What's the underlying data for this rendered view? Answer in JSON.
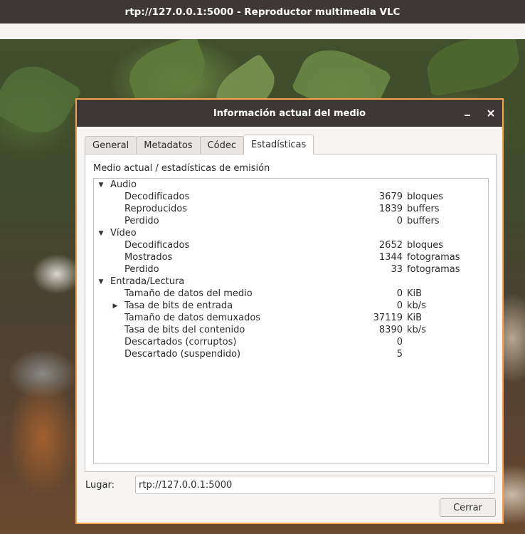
{
  "window": {
    "title": "rtp://127.0.0.1:5000 - Reproductor multimedia VLC"
  },
  "dialog": {
    "title": "Información actual del medio",
    "minimize_icon": "minimize-icon",
    "close_icon": "close-icon",
    "tabs": [
      {
        "label": "General",
        "active": false
      },
      {
        "label": "Metadatos",
        "active": false
      },
      {
        "label": "Códec",
        "active": false
      },
      {
        "label": "Estadísticas",
        "active": true
      }
    ],
    "panel_heading": "Medio actual / estadísticas de emisión",
    "tree": {
      "audio": {
        "label": "Audio",
        "rows": [
          {
            "label": "Decodificados",
            "value": "3679",
            "unit": "bloques"
          },
          {
            "label": "Reproducidos",
            "value": "1839",
            "unit": "buffers"
          },
          {
            "label": "Perdido",
            "value": "0",
            "unit": "buffers"
          }
        ]
      },
      "video": {
        "label": "Vídeo",
        "rows": [
          {
            "label": "Decodificados",
            "value": "2652",
            "unit": "bloques"
          },
          {
            "label": "Mostrados",
            "value": "1344",
            "unit": "fotogramas"
          },
          {
            "label": "Perdido",
            "value": "33",
            "unit": "fotogramas"
          }
        ]
      },
      "input": {
        "label": "Entrada/Lectura",
        "rows": [
          {
            "label": "Tamaño de datos del medio",
            "value": "0",
            "unit": "KiB"
          },
          {
            "label": "Tasa de bits de entrada",
            "value": "0",
            "unit": "kb/s"
          },
          {
            "label": "Tamaño de datos demuxados",
            "value": "37119",
            "unit": "KiB"
          },
          {
            "label": "Tasa de bits del contenido",
            "value": "8390",
            "unit": "kb/s"
          },
          {
            "label": "Descartados (corruptos)",
            "value": "0",
            "unit": ""
          },
          {
            "label": "Descartado (suspendido)",
            "value": "5",
            "unit": ""
          }
        ]
      }
    },
    "location_label": "Lugar:",
    "location_value": "rtp://127.0.0.1:5000",
    "close_button": "Cerrar"
  }
}
